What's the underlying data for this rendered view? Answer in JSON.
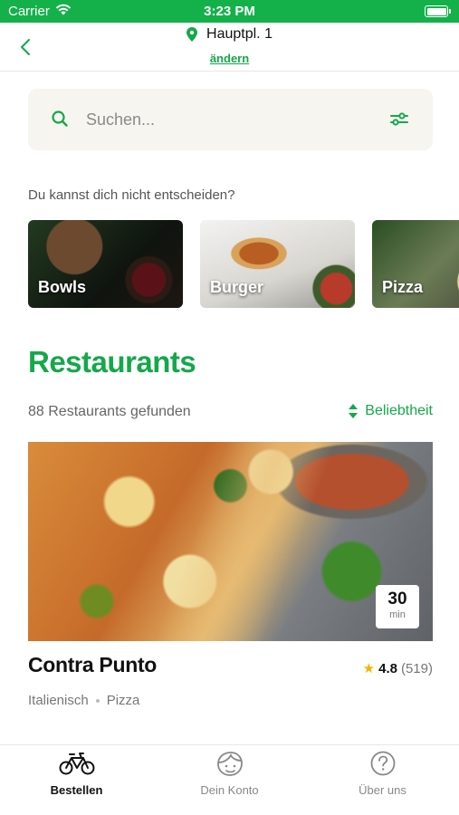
{
  "status_bar": {
    "carrier": "Carrier",
    "time": "3:23 PM"
  },
  "header": {
    "location": "Hauptpl. 1",
    "change_label": "ändern"
  },
  "search": {
    "placeholder": "Suchen..."
  },
  "categories": {
    "prompt": "Du kannst dich nicht entscheiden?",
    "items": [
      {
        "label": "Bowls"
      },
      {
        "label": "Burger"
      },
      {
        "label": "Pizza"
      }
    ]
  },
  "restaurants": {
    "title": "Restaurants",
    "count_text": "88 Restaurants gefunden",
    "sort_label": "Beliebtheit",
    "items": [
      {
        "name": "Contra Punto",
        "delivery_time": "30",
        "delivery_unit": "min",
        "rating": "4.8",
        "reviews": "(519)",
        "tags": [
          "Italienisch",
          "Pizza"
        ]
      }
    ]
  },
  "tabbar": {
    "items": [
      {
        "label": "Bestellen",
        "icon": "bicycle-icon",
        "active": true
      },
      {
        "label": "Dein Konto",
        "icon": "user-face-icon",
        "active": false
      },
      {
        "label": "Über uns",
        "icon": "question-circle-icon",
        "active": false
      }
    ]
  },
  "colors": {
    "brand_green": "#14a84a",
    "status_bar": "#14b14a",
    "search_bg": "#f7f5ef",
    "star": "#f2b400"
  }
}
